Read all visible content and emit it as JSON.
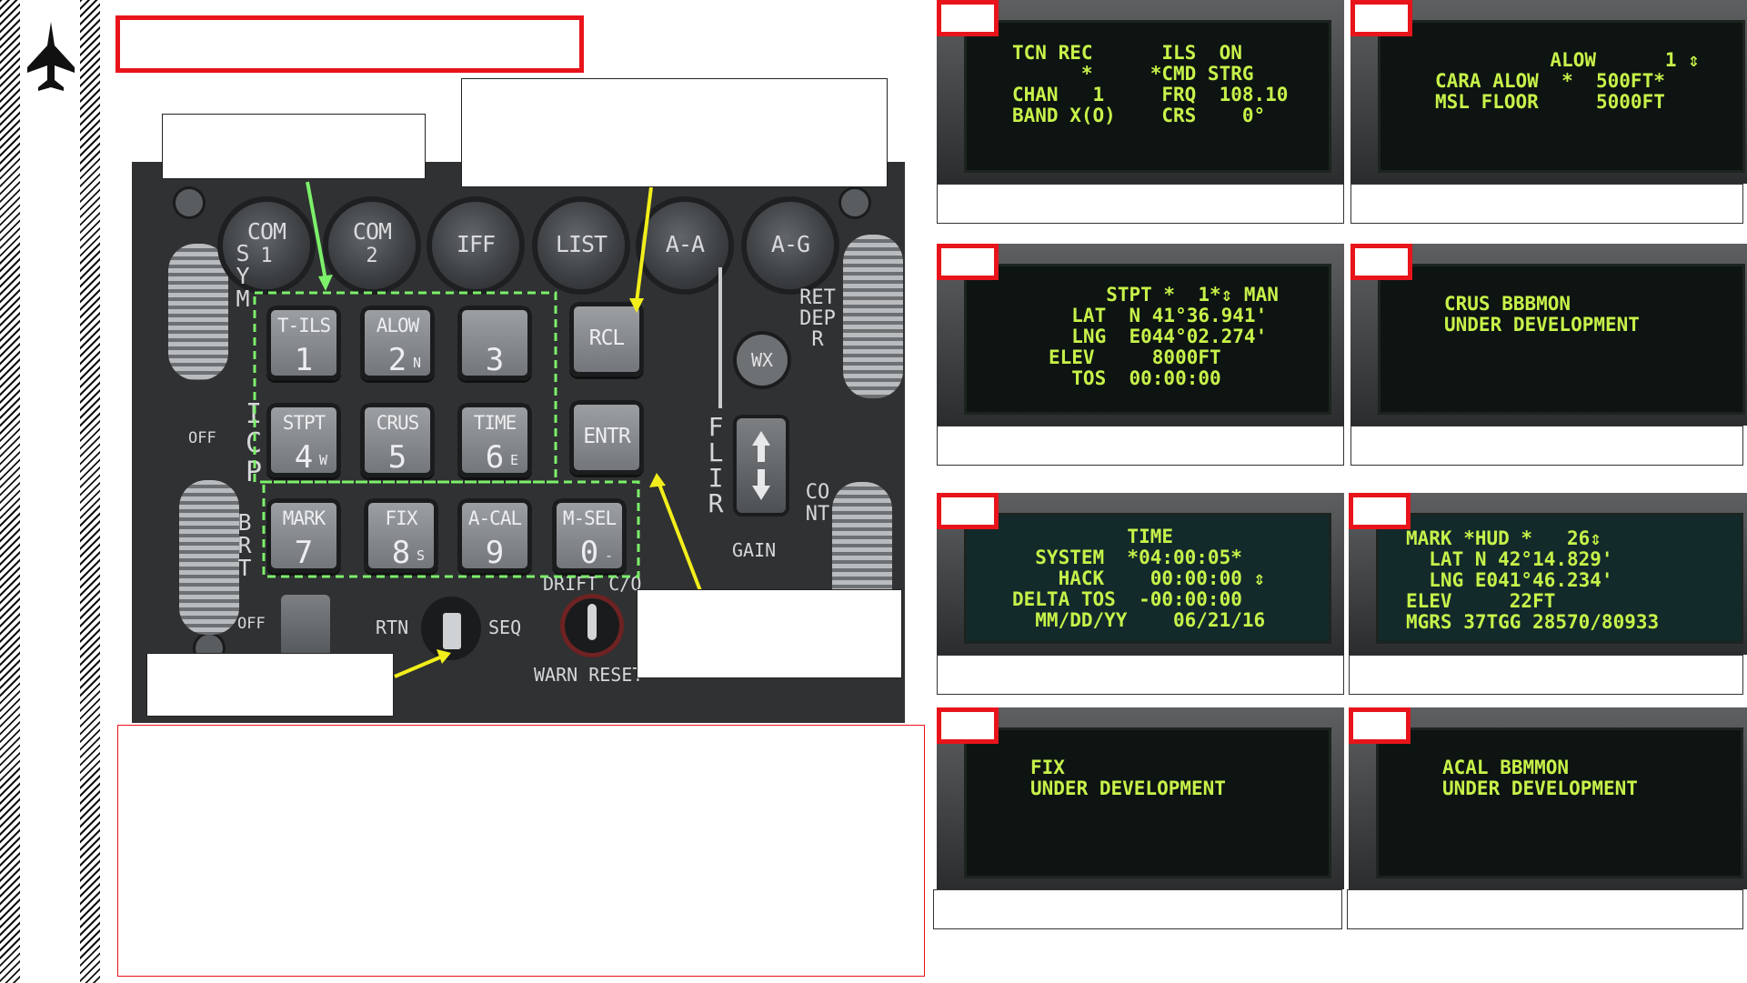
{
  "icp": {
    "round_buttons": [
      {
        "t": "COM",
        "n": "1"
      },
      {
        "t": "COM",
        "n": "2"
      },
      {
        "t": "IFF",
        "n": ""
      },
      {
        "t": "LIST",
        "n": ""
      },
      {
        "t": "A-A",
        "n": ""
      },
      {
        "t": "A-G",
        "n": ""
      }
    ],
    "keys": [
      {
        "t": "T-ILS",
        "n": "1",
        "s": ""
      },
      {
        "t": "ALOW",
        "n": "2",
        "s": "N"
      },
      {
        "t": "",
        "n": "3",
        "s": ""
      },
      {
        "t": "STPT",
        "n": "4",
        "s": "W"
      },
      {
        "t": "CRUS",
        "n": "5",
        "s": ""
      },
      {
        "t": "TIME",
        "n": "6",
        "s": "E"
      },
      {
        "t": "MARK",
        "n": "7",
        "s": ""
      },
      {
        "t": "FIX",
        "n": "8",
        "s": "S"
      },
      {
        "t": "A-CAL",
        "n": "9",
        "s": ""
      },
      {
        "t": "M-SEL",
        "n": "0",
        "s": "-"
      }
    ],
    "rcl": "RCL",
    "entr": "ENTR",
    "wx": "WX",
    "sym": "SYM",
    "icp": "ICP",
    "brt": "BRT",
    "off": "OFF",
    "off2": "OFF",
    "flir": "FLIR",
    "gain": "GAIN",
    "ret_depr": "RET DEPR",
    "cont": "CONT",
    "rtn": "RTN",
    "seq": "SEQ",
    "drift": "DRIFT C/O",
    "warn": "WARN RESET"
  },
  "ded_panels": [
    {
      "lines": [
        "TCN REC      ILS  ON",
        "",
        "      *     *CMD STRG",
        "CHAN   1     FRQ  108.10",
        "BAND X(O)    CRS    0°"
      ]
    },
    {
      "lines": [
        "          ALOW      1 ⇕",
        "",
        "CARA ALOW  *  500FT*",
        "MSL FLOOR     5000FT"
      ]
    },
    {
      "lines": [
        "     STPT *  1*⇕ MAN",
        "  LAT  N 41°36.941'",
        "  LNG  E044°02.274'",
        "ELEV     8000FT",
        "  TOS  00:00:00"
      ]
    },
    {
      "lines": [
        "",
        "CRUS BBBMON",
        "",
        "UNDER DEVELOPMENT"
      ]
    },
    {
      "lines": [
        "          TIME",
        "  SYSTEM  *04:00:05*",
        "    HACK    00:00:00 ⇕",
        "DELTA TOS  -00:00:00",
        "  MM/DD/YY    06/21/16"
      ]
    },
    {
      "lines": [
        "MARK *HUD *   26⇕",
        "  LAT N 42°14.829'",
        "  LNG E041°46.234'",
        "ELEV     22FT",
        "MGRS 37TGG 28570/80933"
      ]
    },
    {
      "lines": [
        "",
        "FIX",
        "",
        "UNDER DEVELOPMENT"
      ]
    },
    {
      "lines": [
        "",
        "ACAL BBMMON",
        "",
        "UNDER DEVELOPMENT"
      ]
    }
  ],
  "colors": {
    "accent_red": "#e8141b",
    "callout_green": "#7cf06a",
    "callout_yellow": "#f2ee1b",
    "ded_text": "#c7f24a"
  },
  "icons": {
    "sidebar": "jet-fighter-icon"
  }
}
